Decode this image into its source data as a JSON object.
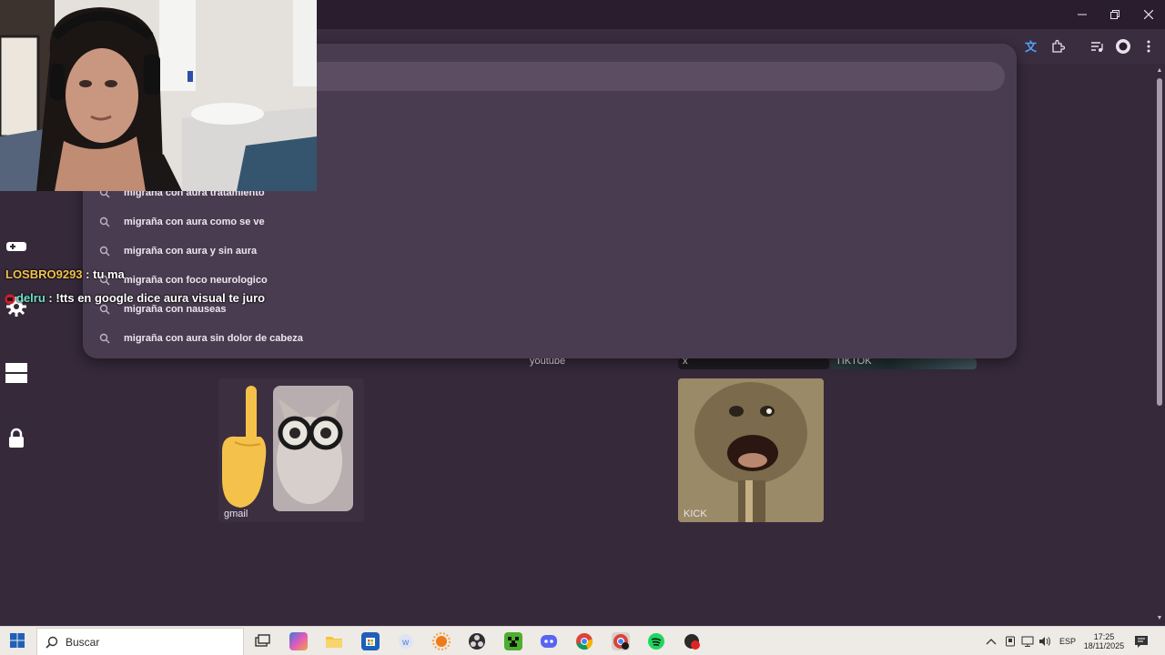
{
  "window": {
    "minimize_icon": "minimize-icon",
    "restore_icon": "restore-icon",
    "close_icon": "close-icon"
  },
  "toolbar": {
    "icons": [
      "translate-icon",
      "extensions-icon",
      "media-controls-icon",
      "profile-icon",
      "menu-icon"
    ]
  },
  "omnibox": {
    "suggestions": [
      "migraña con aura tratamiento",
      "migraña con aura como se ve",
      "migraña con aura y sin aura",
      "migraña con foco neurologico",
      "migraña con nauseas",
      "migraña con aura sin dolor de cabeza"
    ]
  },
  "shortcuts": [
    {
      "label": "youtube"
    },
    {
      "label": "x"
    },
    {
      "label": "TIKTOK"
    },
    {
      "label": "gmail"
    },
    {
      "label": "KICK"
    }
  ],
  "chat": [
    {
      "user": "LOSBRO9293",
      "sep": " : ",
      "message": "tu ma",
      "color": "#f2c14e"
    },
    {
      "user": "delru",
      "sep": " : ",
      "message": "!tts en google dice aura visual te juro",
      "color": "#6fe0c8"
    }
  ],
  "taskbar": {
    "search_placeholder": "Buscar",
    "language": "ESP",
    "time": "17:25",
    "date": "18/11/2025"
  },
  "colors": {
    "page_bg": "#35293a",
    "omnibox_bg": "#4a3c50",
    "accent_translate": "#4fa3f7"
  }
}
